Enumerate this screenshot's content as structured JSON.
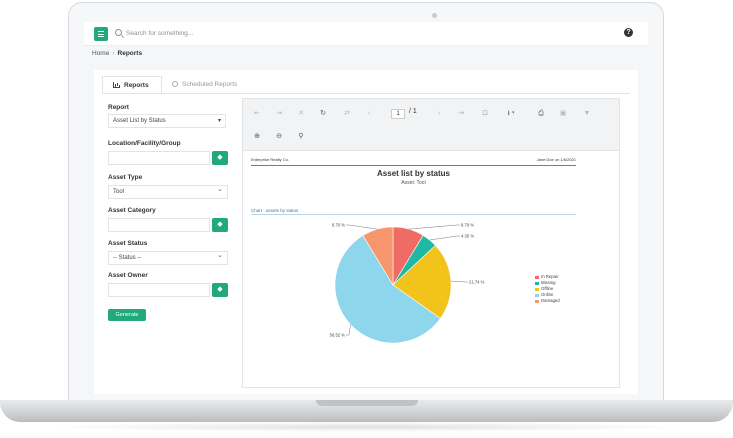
{
  "header": {
    "search_placeholder": "Search for something..."
  },
  "breadcrumb": {
    "home": "Home",
    "separator": "›",
    "current": "Reports"
  },
  "tabs": [
    {
      "label": "Reports",
      "active": true
    },
    {
      "label": "Scheduled Reports",
      "active": false
    }
  ],
  "form": {
    "report_label": "Report",
    "report_value": "Asset List by Status",
    "location_label": "Location/Facility/Group",
    "asset_type_label": "Asset Type",
    "asset_type_value": "Tool",
    "asset_category_label": "Asset Category",
    "asset_status_label": "Asset Status",
    "asset_status_value": "-- Status --",
    "asset_owner_label": "Asset Owner",
    "generate_label": "Generate"
  },
  "viewer": {
    "page_current": "1",
    "page_total": "/ 1"
  },
  "report": {
    "company": "Enterprise Realty Co.",
    "user_date": "Jane Doe on 1/6/2021",
    "title": "Asset list by status",
    "subtitle": "Asset: Tool",
    "chart_caption": "Chart - assets by status"
  },
  "chart_data": {
    "type": "pie",
    "categories": [
      "In Repair",
      "Missing",
      "Offline",
      "Online",
      "Damaged"
    ],
    "values": [
      8.7,
      4.35,
      21.74,
      56.52,
      8.7
    ],
    "labels": [
      "8.70 %",
      "4.35 %",
      "21.74 %",
      "56.52 %",
      "8.70 %"
    ],
    "colors": [
      "#ef6b63",
      "#1fb8a4",
      "#f2c31a",
      "#8dd6ec",
      "#f7956d"
    ],
    "legend": "right"
  }
}
